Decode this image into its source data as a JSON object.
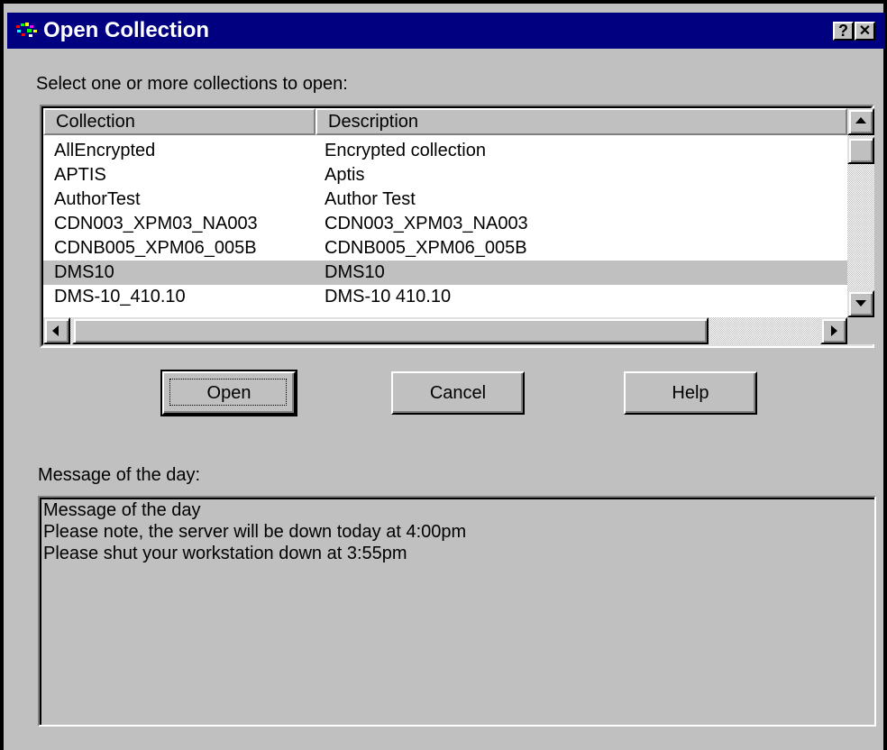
{
  "window": {
    "title": "Open Collection",
    "help_button": "?",
    "close_button": "✕"
  },
  "prompt": "Select one or more collections to open:",
  "columns": [
    "Collection",
    "Description"
  ],
  "rows": [
    {
      "collection": "AllEncrypted",
      "description": "Encrypted collection",
      "selected": false
    },
    {
      "collection": "APTIS",
      "description": "Aptis",
      "selected": false
    },
    {
      "collection": "AuthorTest",
      "description": "Author Test",
      "selected": false
    },
    {
      "collection": "CDN003_XPM03_NA003",
      "description": "CDN003_XPM03_NA003",
      "selected": false
    },
    {
      "collection": "CDNB005_XPM06_005B",
      "description": "CDNB005_XPM06_005B",
      "selected": false
    },
    {
      "collection": "DMS10",
      "description": "DMS10",
      "selected": true
    },
    {
      "collection": "DMS-10_410.10",
      "description": "DMS-10 410.10",
      "selected": false
    }
  ],
  "buttons": {
    "open": "Open",
    "cancel": "Cancel",
    "help": "Help"
  },
  "motd_label": "Message of the day:",
  "motd_lines": [
    "Message of the day",
    "Please note, the server will be down today at 4:00pm",
    "Please shut your workstation down at 3:55pm"
  ],
  "colors": {
    "titlebar": "#000080",
    "face": "#c0c0c0",
    "selected_row": "#c0c0c0"
  },
  "icons": {
    "app": "app-icon",
    "help": "help-icon",
    "close": "close-icon",
    "scroll_up": "arrow-up-icon",
    "scroll_down": "arrow-down-icon",
    "scroll_left": "arrow-left-icon",
    "scroll_right": "arrow-right-icon"
  }
}
